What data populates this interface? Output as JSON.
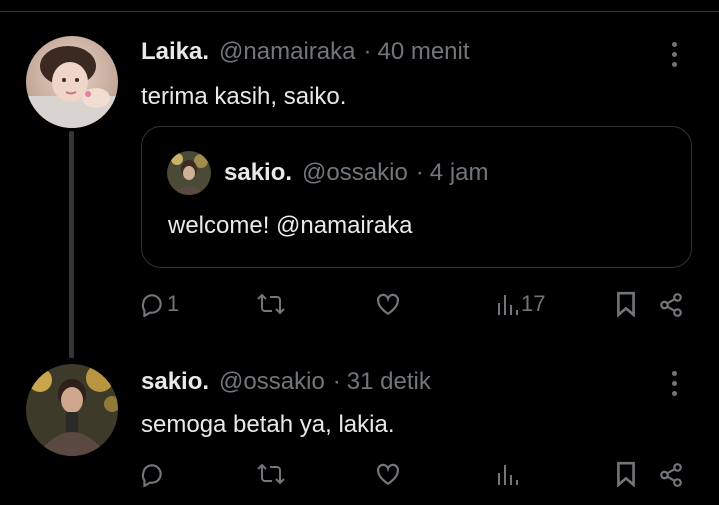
{
  "tweets": [
    {
      "name": "Laika.",
      "handle": "@namairaka",
      "separator": "·",
      "time": "40 menit",
      "text": "terima kasih, saiko.",
      "quote": {
        "name": "sakio.",
        "handle": "@ossakio",
        "separator": "·",
        "time": "4 jam",
        "text": "welcome! @namairaka"
      },
      "actions": {
        "reply_count": "1",
        "views_count": "17"
      }
    },
    {
      "name": "sakio.",
      "handle": "@ossakio",
      "separator": "·",
      "time": "31 detik",
      "text": "semoga betah ya, lakia."
    }
  ],
  "icons": [
    "reply-icon",
    "retweet-icon",
    "like-icon",
    "views-icon",
    "bookmark-icon",
    "share-icon",
    "more-icon"
  ],
  "colors": {
    "background": "#000000",
    "text": "#e7e9ea",
    "secondary": "#71767b",
    "border": "#2f3336"
  }
}
